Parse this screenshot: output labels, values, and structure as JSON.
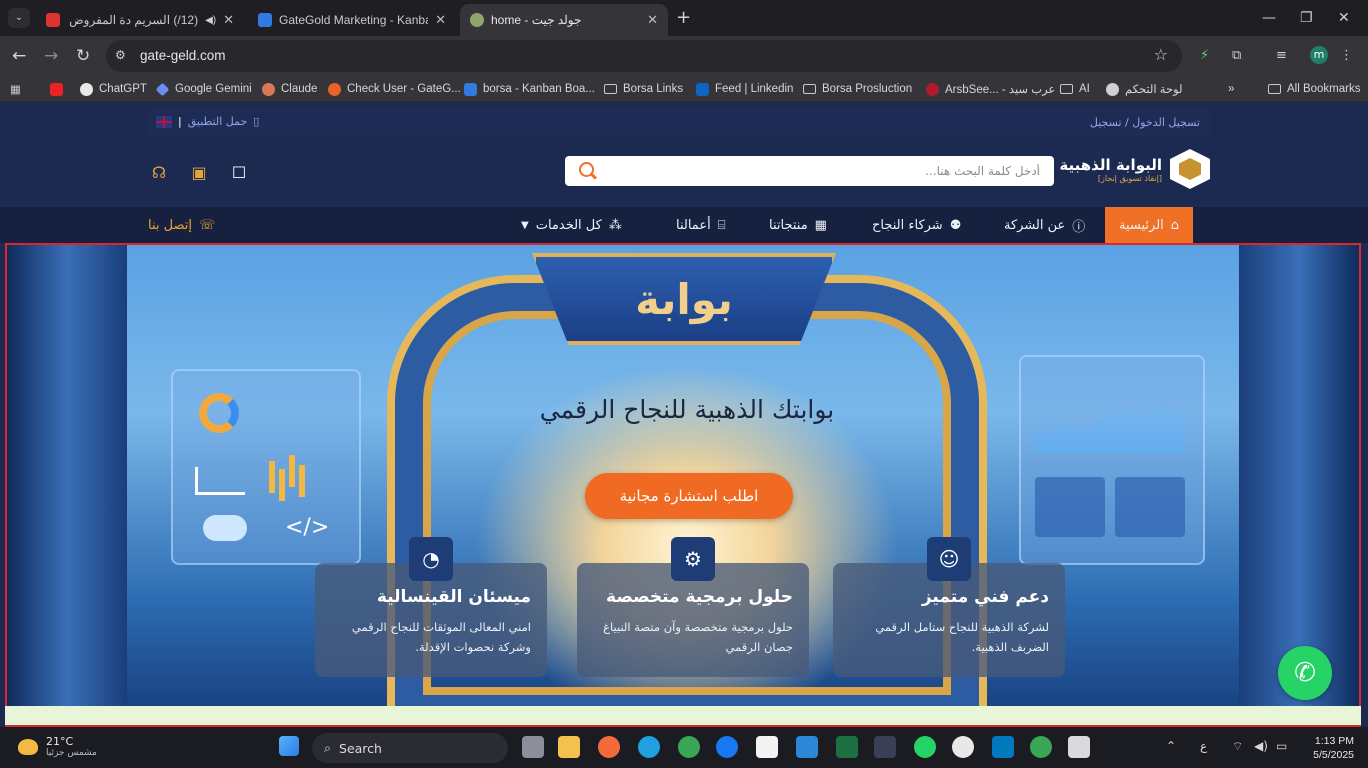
{
  "browser": {
    "tabs": [
      {
        "title": "(12/) السريم دة المفروض",
        "fav": "#d33",
        "audio": true,
        "active": false
      },
      {
        "title": "GateGold Marketing - Kanban B",
        "fav": "#2f7be0",
        "active": false
      },
      {
        "title": "home - جولد جيت",
        "fav": "#8fa66a",
        "active": true
      }
    ],
    "url": "gate-geld.com",
    "profile_initial": "m",
    "bookmarks": [
      {
        "label": "",
        "type": "yt"
      },
      {
        "label": "ChatGPT",
        "type": "chatgpt"
      },
      {
        "label": "Google Gemini",
        "type": "gemini"
      },
      {
        "label": "Claude",
        "type": "claude"
      },
      {
        "label": "Check User - GateG...",
        "type": "check"
      },
      {
        "label": "borsa - Kanban Boa...",
        "type": "kanban"
      },
      {
        "label": "Borsa Links",
        "type": "folder"
      },
      {
        "label": "Feed | Linkedin",
        "type": "linkedin"
      },
      {
        "label": "Borsa Prosluction",
        "type": "folder"
      },
      {
        "label": "ArsbSee... - عرب سيد",
        "type": "arab"
      },
      {
        "label": "AI",
        "type": "folder"
      },
      {
        "label": "لوحة التحكم",
        "type": "dash"
      },
      {
        "label": "All Bookmarks",
        "type": "folder"
      }
    ]
  },
  "site": {
    "top_login": "تسجيل الدخول / تسجيل",
    "top_app": "حمل التطبيق",
    "brand_name": "البوابة الذهبية",
    "brand_sub": "[إنقاذ تسويق إنجاز]",
    "search_placeholder": "أدخل كلمة البحث هنا...",
    "nav": {
      "home": "الرئيسية",
      "about": "عن الشركة",
      "partners": "شركاء النجاح",
      "products": "منتجاتنا",
      "works": "أعمالنا",
      "services": "كل الخدمات",
      "contact": "إتصل بنا"
    },
    "hero": {
      "sign": "بوابة",
      "headline": "بوابتك الذهبية للنجاح الرقمي",
      "cta": "اطلب استشارة مجانية",
      "cards": [
        {
          "title": "دعم فني متميز",
          "desc": "لشركة الذهبية للنجاح ستامل الرقمي الضربف الذهبية."
        },
        {
          "title": "حلول برمجية متخصصة",
          "desc": "حلول برمجية متخصصة وآن متصة النبياغ جصان الرقمي"
        },
        {
          "title": "ميسئان القينسالية",
          "desc": "امني المعالى الموثقات للنجاح الرقمي وشركة نحصوات الإقدلة."
        }
      ]
    }
  },
  "taskbar": {
    "weather_temp": "21°C",
    "weather_desc": "مشمس جزئيا",
    "search": "Search",
    "time": "1:13 PM",
    "date": "5/5/2025",
    "lang": "ع"
  },
  "colors": {
    "accent": "#f07026",
    "navy": "#1c2950",
    "gold": "#d8a646",
    "whatsapp": "#25d366"
  }
}
